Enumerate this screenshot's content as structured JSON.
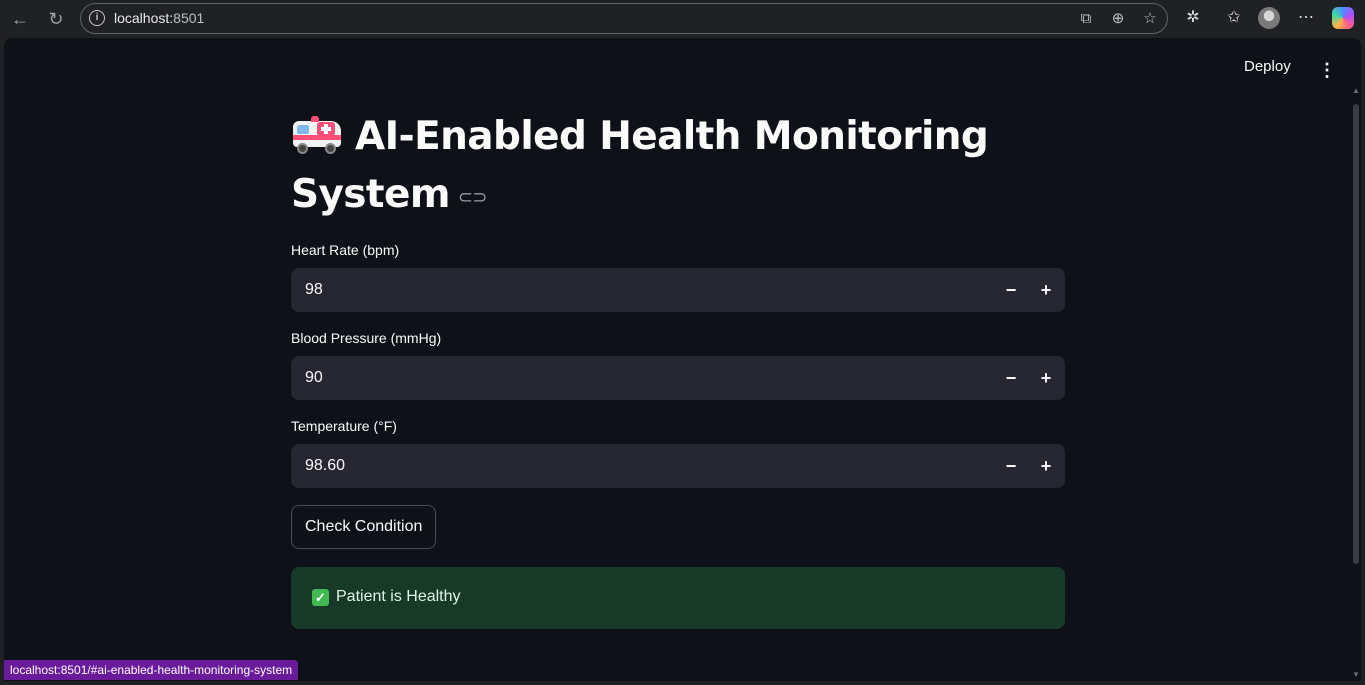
{
  "browser": {
    "url_host": "localhost:",
    "url_port": "8501",
    "status_link": "localhost:8501/#ai-enabled-health-monitoring-system"
  },
  "header": {
    "deploy_label": "Deploy"
  },
  "page": {
    "title": "AI-Enabled Health Monitoring System",
    "title_icon": "ambulance-icon"
  },
  "form": {
    "fields": [
      {
        "label": "Heart Rate (bpm)",
        "value": "98"
      },
      {
        "label": "Blood Pressure (mmHg)",
        "value": "90"
      },
      {
        "label": "Temperature (°F)",
        "value": "98.60"
      }
    ],
    "minus_symbol": "−",
    "plus_symbol": "+",
    "submit_label": "Check Condition"
  },
  "result": {
    "message": "Patient is Healthy",
    "icon": "check-mark-icon",
    "color": "#173928"
  },
  "colors": {
    "app_bg": "#0e1117",
    "input_bg": "#262730",
    "status_bar": "#6a1b9a"
  }
}
